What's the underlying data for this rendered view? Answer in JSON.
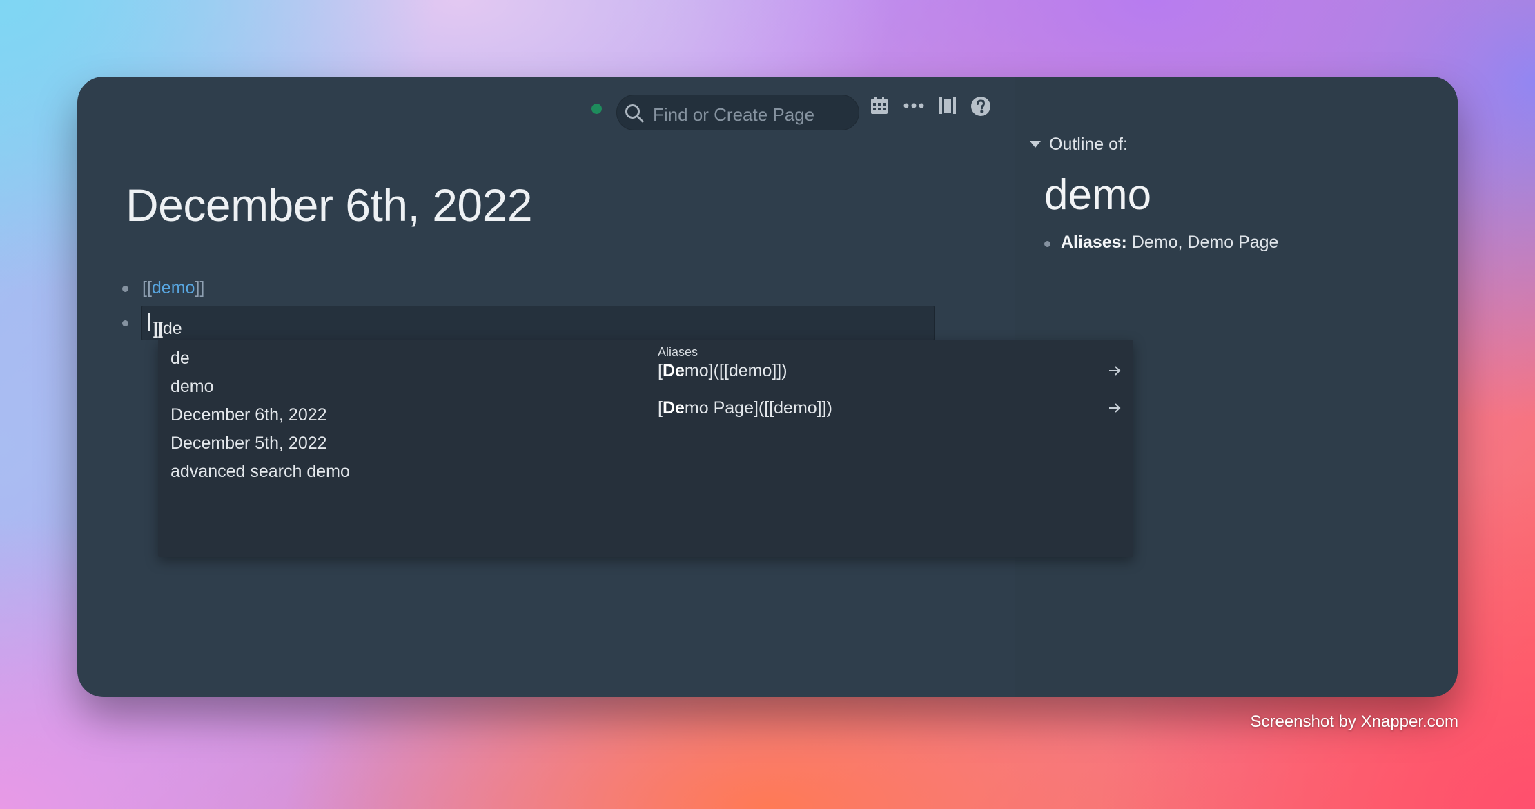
{
  "toolbar": {
    "search_placeholder": "Find or Create Page",
    "icons": [
      "sync-status-dot",
      "search-icon",
      "calendar-icon",
      "more-icon",
      "sidebar-toggle-icon",
      "help-icon"
    ],
    "sync_color": "#1e8c5c"
  },
  "page": {
    "title": "December 6th, 2022",
    "blocks": [
      {
        "prefix": "[[",
        "link": "demo",
        "suffix": "]]"
      }
    ],
    "editing": {
      "before_caret": "[[de",
      "after_caret": "]]"
    }
  },
  "autocomplete": {
    "items": [
      "de",
      "demo",
      "December 6th, 2022",
      "December 5th, 2022",
      "advanced search demo"
    ],
    "aliases_header": "Aliases",
    "aliases": [
      {
        "open": "[",
        "match": "De",
        "rest": "mo]([[demo]])"
      },
      {
        "open": "[",
        "match": "De",
        "rest": "mo Page]([[demo]])"
      }
    ]
  },
  "sidebar": {
    "outline_label": "Outline of:",
    "title": "demo",
    "property_label": "Aliases:",
    "property_value": " Demo, Demo Page"
  },
  "watermark": "Screenshot by Xnapper.com",
  "colors": {
    "window_bg": "#2f3e4c",
    "link": "#58a6e0",
    "popup_bg": "#26303b"
  }
}
